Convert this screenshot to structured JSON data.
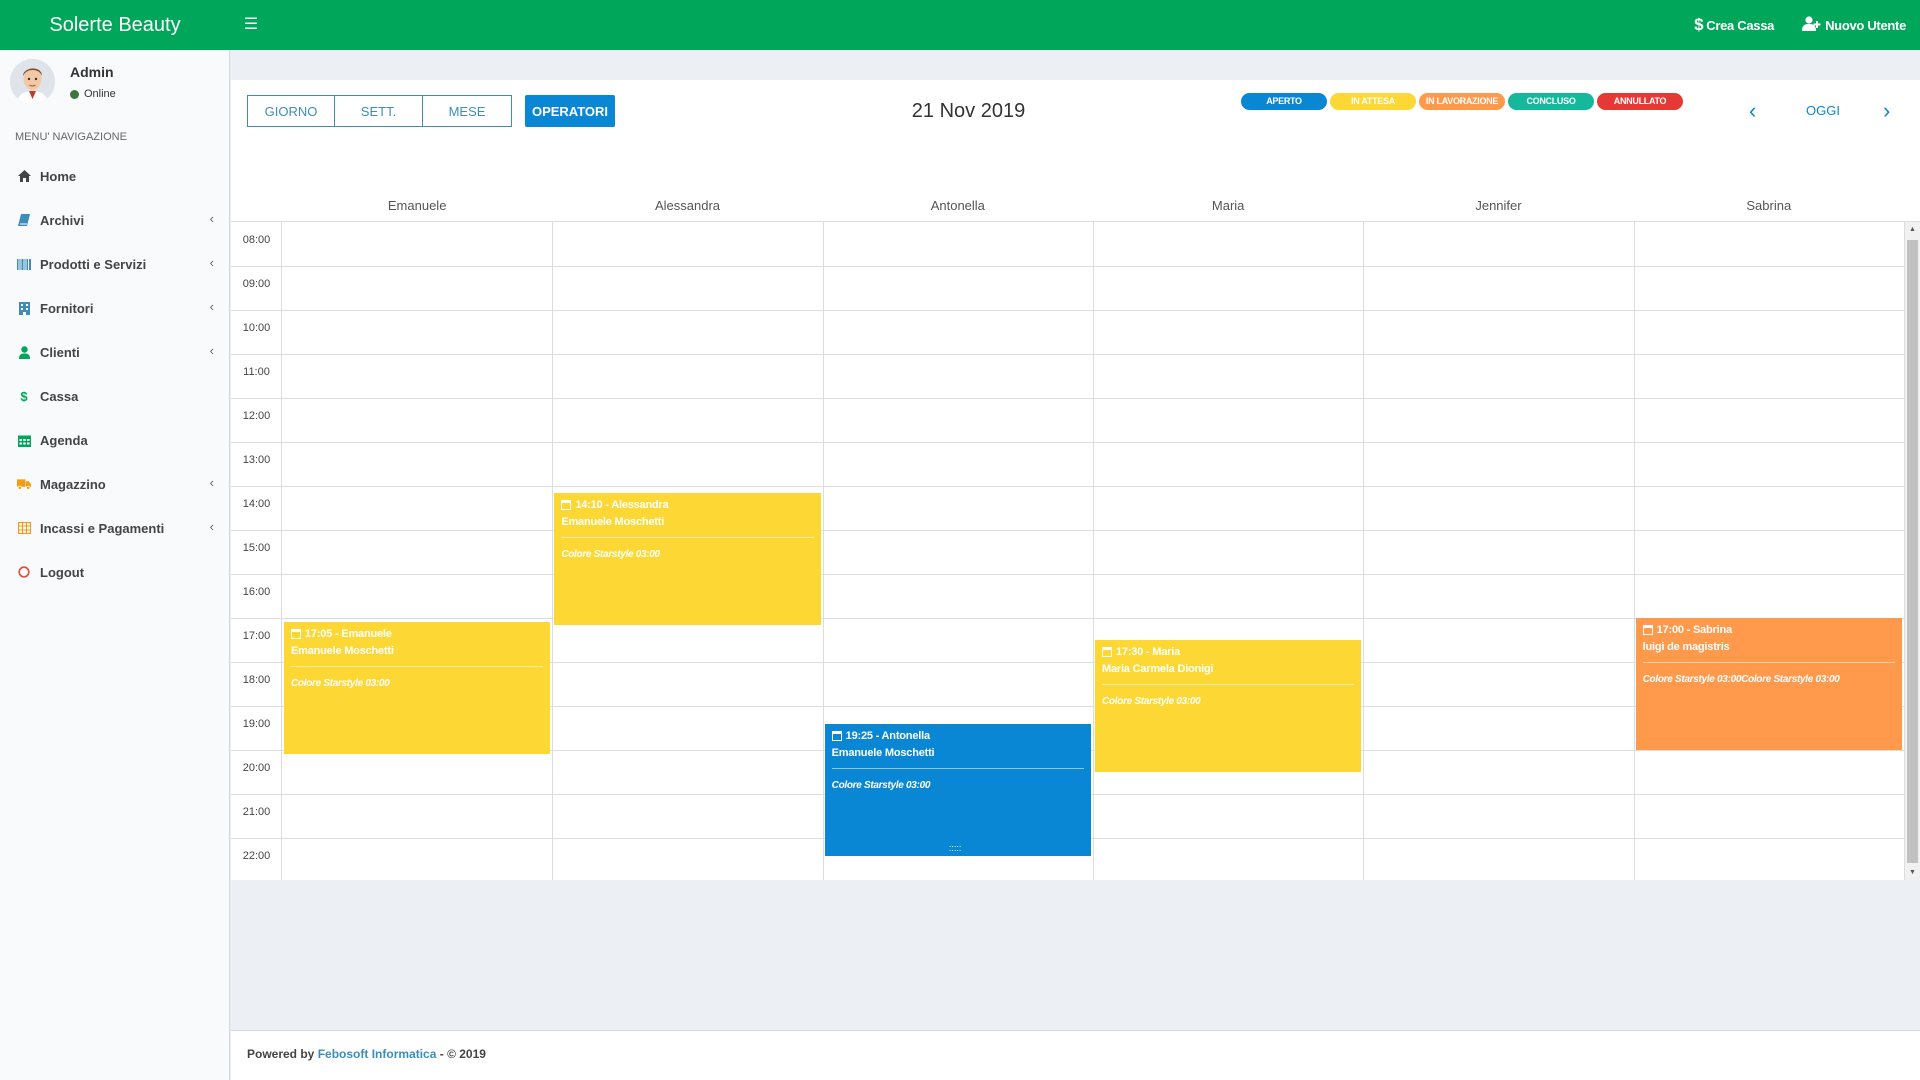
{
  "header": {
    "brand": "Solerte Beauty",
    "actions": [
      {
        "label": "Crea Cassa",
        "icon": "dollar-icon"
      },
      {
        "label": "Nuovo Utente",
        "icon": "add-user-icon"
      }
    ]
  },
  "user": {
    "name": "Admin",
    "status": "Online"
  },
  "sidebar": {
    "header": "MENU' NAVIGAZIONE",
    "items": [
      {
        "label": "Home",
        "icon": "home-icon",
        "color": "#444444",
        "submenu": false
      },
      {
        "label": "Archivi",
        "icon": "book-icon",
        "color": "#3c8dbc",
        "submenu": true
      },
      {
        "label": "Prodotti e Servizi",
        "icon": "barcode-icon",
        "color": "#3c8dbc",
        "submenu": true
      },
      {
        "label": "Fornitori",
        "icon": "building-icon",
        "color": "#3c8dbc",
        "submenu": true
      },
      {
        "label": "Clienti",
        "icon": "user-icon",
        "color": "#00a65a",
        "submenu": true
      },
      {
        "label": "Cassa",
        "icon": "dollar-icon",
        "color": "#00a65a",
        "submenu": false
      },
      {
        "label": "Agenda",
        "icon": "calendar-icon",
        "color": "#00a65a",
        "submenu": false
      },
      {
        "label": "Magazzino",
        "icon": "truck-icon",
        "color": "#f39c12",
        "submenu": true
      },
      {
        "label": "Incassi e Pagamenti",
        "icon": "table-icon",
        "color": "#f39c12",
        "submenu": true
      },
      {
        "label": "Logout",
        "icon": "power-icon",
        "color": "#dd4b39",
        "submenu": false
      }
    ]
  },
  "toolbar": {
    "views": [
      "GIORNO",
      "SETT.",
      "MESE"
    ],
    "operators_label": "OPERATORI",
    "date": "21 Nov 2019",
    "today_label": "OGGI",
    "prev_icon": "chevron-left-icon",
    "next_icon": "chevron-right-icon"
  },
  "legend": [
    {
      "label": "APERTO",
      "color": "#0a87d4"
    },
    {
      "label": "IN ATTESA",
      "color": "#fdd835"
    },
    {
      "label": "IN LAVORAZIONE",
      "color": "#ff9a4d"
    },
    {
      "label": "CONCLUSO",
      "color": "#14b89a"
    },
    {
      "label": "ANNULLATO",
      "color": "#e53935"
    }
  ],
  "calendar": {
    "operators": [
      "Emanuele",
      "Alessandra",
      "Antonella",
      "Maria",
      "Jennifer",
      "Sabrina"
    ],
    "times": [
      "08:00",
      "09:00",
      "10:00",
      "11:00",
      "12:00",
      "13:00",
      "14:00",
      "15:00",
      "16:00",
      "17:00",
      "18:00",
      "19:00",
      "20:00",
      "21:00",
      "22:00"
    ],
    "events": [
      {
        "operator": 1,
        "start": "14:10",
        "end": "17:10",
        "time_label": "14:10 - Alessandra",
        "client": "Emanuele Moschetti",
        "service": "Colore Starstyle 03:00",
        "color": "#fdd835"
      },
      {
        "operator": 0,
        "start": "17:05",
        "end": "20:05",
        "time_label": "17:05 - Emanuele",
        "client": "Emanuele Moschetti",
        "service": "Colore Starstyle 03:00",
        "color": "#fdd835"
      },
      {
        "operator": 3,
        "start": "17:30",
        "end": "20:30",
        "time_label": "17:30 - Maria",
        "client": "Maria Carmela Dionigi",
        "service": "Colore Starstyle 03:00",
        "color": "#fdd835"
      },
      {
        "operator": 2,
        "start": "19:25",
        "end": "22:25",
        "time_label": "19:25 - Antonella",
        "client": "Emanuele Moschetti",
        "service": "Colore Starstyle 03:00",
        "color": "#0a87d4",
        "grip": ":::::"
      },
      {
        "operator": 5,
        "start": "17:00",
        "end": "20:00",
        "time_label": "17:00 - Sabrina",
        "client": "luigi de magistris",
        "service": "Colore Starstyle 03:00Colore Starstyle 03:00",
        "color": "#ff9a4d"
      }
    ]
  },
  "footer": {
    "prefix": "Powered by",
    "company": "Febosoft Informatica",
    "suffix": "- © 2019"
  }
}
